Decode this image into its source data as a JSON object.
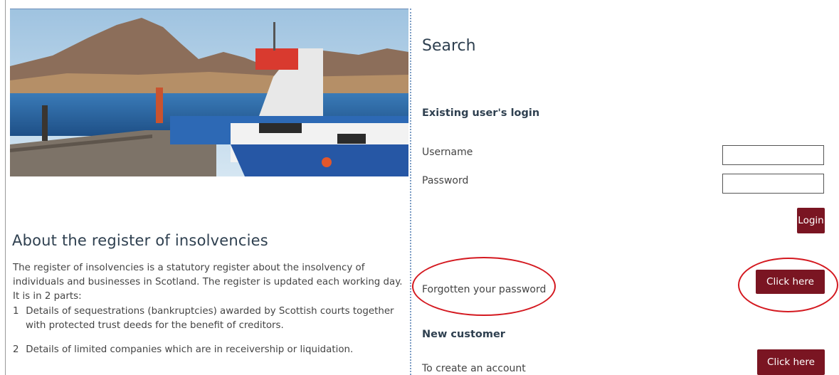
{
  "about": {
    "title": "About the register of insolvencies",
    "intro": "The register of insolvencies is a statutory register about the insolvency of individuals and businesses in Scotland. The register is updated each working day. It is in 2 parts:",
    "items": [
      {
        "num": "1",
        "line1": "Details of sequestrations (bankruptcies) awarded by Scottish courts together",
        "line2": "with protected trust deeds for the benefit of creditors."
      },
      {
        "num": "2",
        "line1": "Details of limited companies which are in receivership or liquidation.",
        "line2": ""
      }
    ]
  },
  "search": {
    "title": "Search"
  },
  "login": {
    "heading": "Existing user's login",
    "username_label": "Username",
    "username_value": "",
    "password_label": "Password",
    "password_value": "",
    "login_button": "Login"
  },
  "forgotten": {
    "label": "Forgotten your password",
    "button": "Click here"
  },
  "new_customer": {
    "heading": "New customer",
    "label": "To create an account",
    "button": "Click here"
  },
  "colors": {
    "button_bg": "#7a1522",
    "heading": "#2f4050",
    "annotation": "#d41920",
    "divider": "#7b9cc4"
  }
}
